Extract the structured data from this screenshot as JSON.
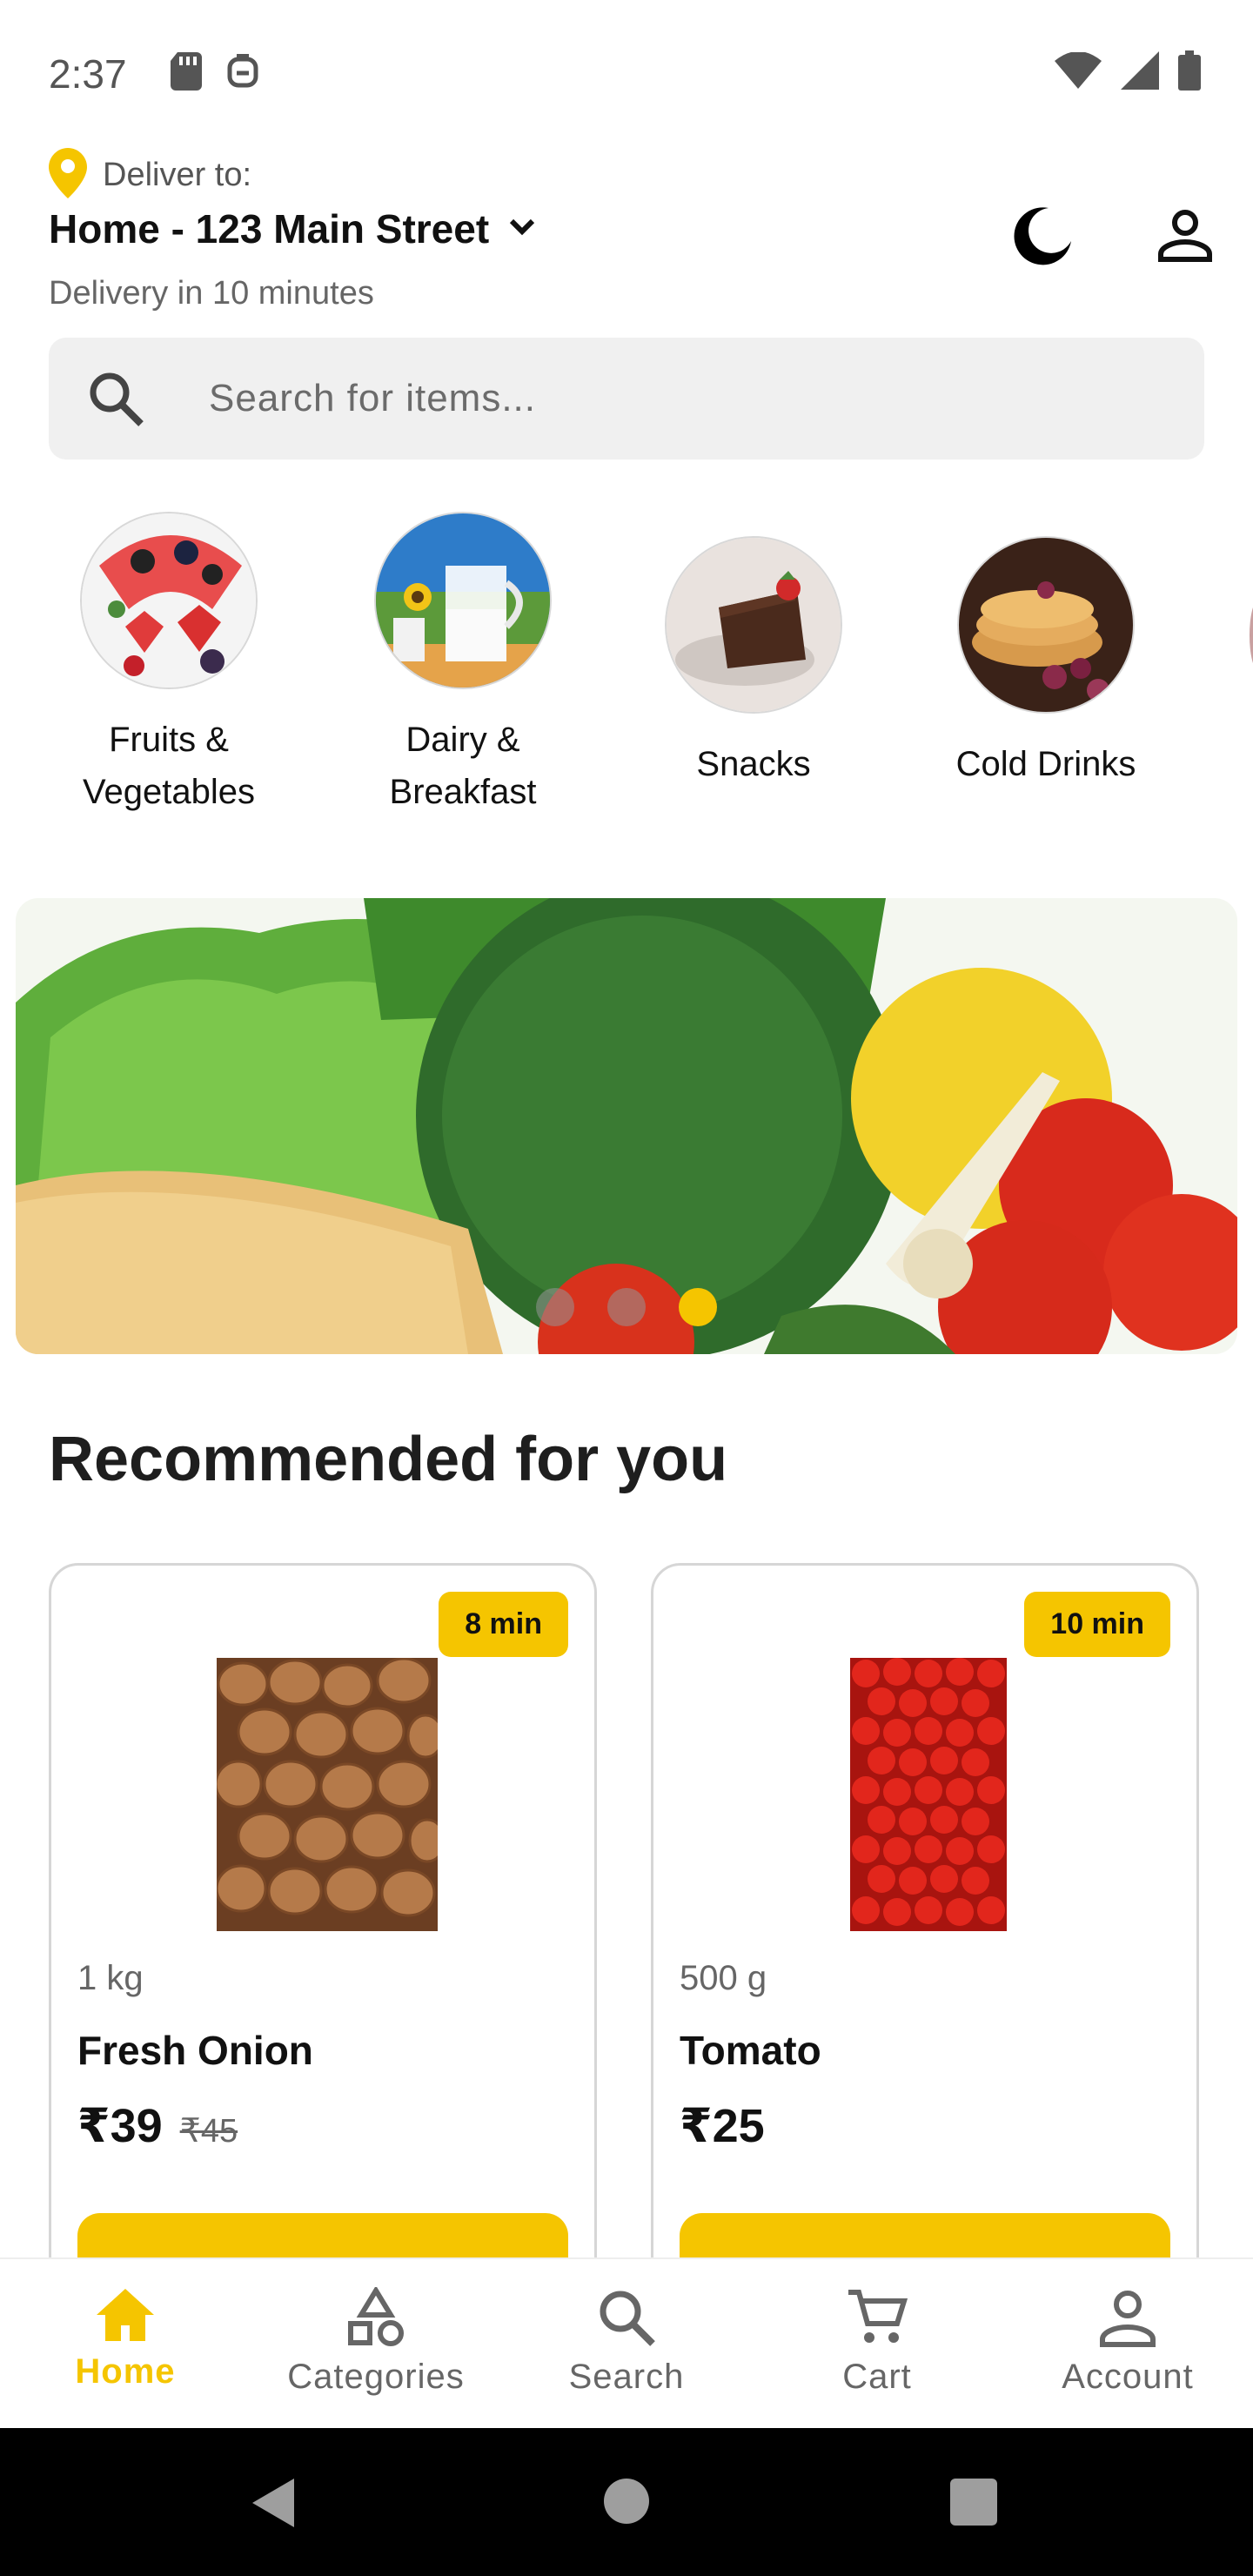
{
  "status_bar": {
    "time": "2:37",
    "icons_left": [
      "sd-card-icon",
      "notification-icon"
    ],
    "icons_right": [
      "wifi-icon",
      "signal-icon",
      "battery-icon"
    ]
  },
  "header": {
    "deliver_label": "Deliver to:",
    "address": "Home - 123 Main Street",
    "eta": "Delivery in 10 minutes"
  },
  "search": {
    "placeholder": "Search for items..."
  },
  "categories": [
    {
      "label_line1": "Fruits &",
      "label_line2": "Vegetables"
    },
    {
      "label_line1": "Dairy &",
      "label_line2": "Breakfast"
    },
    {
      "label_line1": "Snacks",
      "label_line2": ""
    },
    {
      "label_line1": "Cold Drinks",
      "label_line2": ""
    }
  ],
  "banner": {
    "slide_count": 3,
    "active_slide": 3
  },
  "recommended": {
    "title": "Recommended for you",
    "products": [
      {
        "badge": "8 min",
        "weight": "1 kg",
        "name": "Fresh Onion",
        "price": "₹39",
        "mrp": "₹45"
      },
      {
        "badge": "10 min",
        "weight": "500 g",
        "name": "Tomato",
        "price": "₹25",
        "mrp": ""
      }
    ]
  },
  "bottom_nav": {
    "items": [
      {
        "label": "Home",
        "icon": "home-icon",
        "active": true
      },
      {
        "label": "Categories",
        "icon": "categories-icon",
        "active": false
      },
      {
        "label": "Search",
        "icon": "search-icon",
        "active": false
      },
      {
        "label": "Cart",
        "icon": "cart-icon",
        "active": false
      },
      {
        "label": "Account",
        "icon": "account-icon",
        "active": false
      }
    ]
  },
  "colors": {
    "accent": "#f5c500",
    "search_bg": "#f0f0f0",
    "text_primary": "#111111",
    "text_secondary": "#666666"
  }
}
